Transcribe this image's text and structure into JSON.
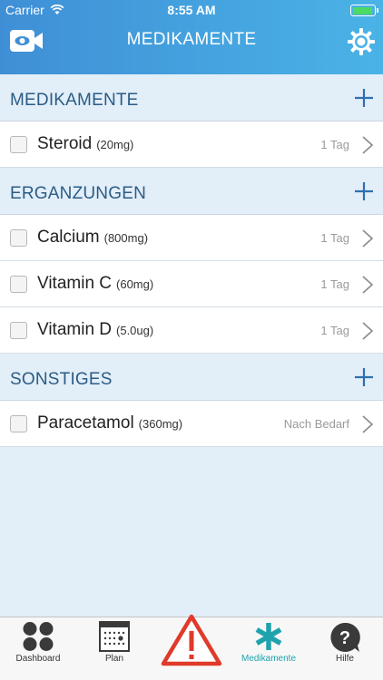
{
  "status_bar": {
    "carrier": "Carrier",
    "time": "8:55 AM"
  },
  "header": {
    "title": "MEDIKAMENTE",
    "left_icon": "video-camera-icon",
    "right_icon": "settings-gear-icon"
  },
  "sections": [
    {
      "title": "MEDIKAMENTE",
      "items": [
        {
          "name": "Steroid",
          "dose": "(20mg)",
          "frequency": "1 Tag"
        }
      ]
    },
    {
      "title": "ERGANZUNGEN",
      "items": [
        {
          "name": "Calcium",
          "dose": "(800mg)",
          "frequency": "1 Tag"
        },
        {
          "name": "Vitamin C",
          "dose": "(60mg)",
          "frequency": "1 Tag"
        },
        {
          "name": "Vitamin D",
          "dose": "(5.0ug)",
          "frequency": "1 Tag"
        }
      ]
    },
    {
      "title": "SONSTIGES",
      "items": [
        {
          "name": "Paracetamol",
          "dose": "(360mg)",
          "frequency": "Nach Bedarf"
        }
      ]
    }
  ],
  "tabs": [
    {
      "label": "Dashboard",
      "icon": "dashboard-circles-icon"
    },
    {
      "label": "Plan",
      "icon": "calendar-icon"
    },
    {
      "label": "",
      "icon": "warning-triangle-icon"
    },
    {
      "label": "Medikamente",
      "icon": "asterisk-icon",
      "active": true
    },
    {
      "label": "Hilfe",
      "icon": "help-question-icon"
    }
  ],
  "colors": {
    "header_start": "#3f8fd6",
    "header_end": "#4ab3e6",
    "section_text": "#2b5c86",
    "add_blue": "#2f6fb0",
    "active_tab": "#1ea3ad",
    "alert_red": "#e03a2a"
  }
}
